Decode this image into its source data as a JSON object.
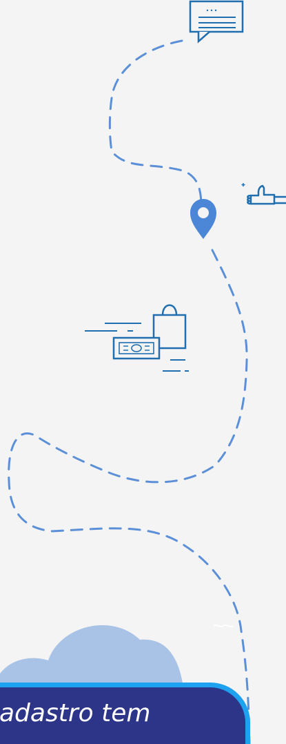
{
  "banner": {
    "text": "adastro tem"
  },
  "icons": {
    "chat": "chat-bubble-icon",
    "thumb": "thumbs-up-icon",
    "pin": "location-pin-icon",
    "payment": "payment-shopping-icon",
    "cloud": "cloud-icon",
    "wave": "wave-icon"
  },
  "colors": {
    "background": "#f4f4f4",
    "path": "#5b8fd7",
    "icon_outline": "#1f6fb0",
    "pin": "#4b87d6",
    "cloud": "#a9c3e7",
    "banner": "#2d3589",
    "banner_border": "#1ea1ef"
  }
}
